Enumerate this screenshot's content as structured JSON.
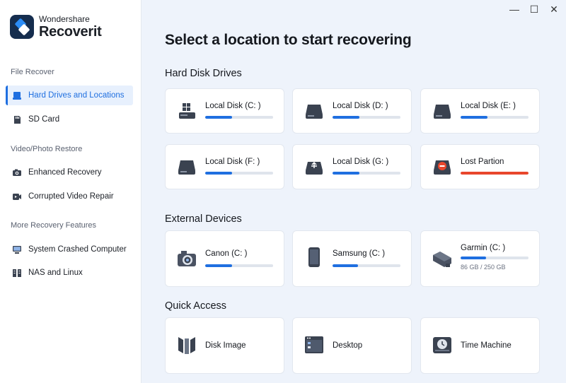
{
  "brand": {
    "line1": "Wondershare",
    "line2": "Recoverit"
  },
  "sidebar": {
    "sections": [
      {
        "label": "File Recover"
      },
      {
        "label": "Video/Photo Restore"
      },
      {
        "label": "More Recovery Features"
      }
    ],
    "items": [
      {
        "label": "Hard Drives and Locations",
        "icon": "hard-drive-icon",
        "active": true
      },
      {
        "label": "SD Card",
        "icon": "sd-card-icon"
      },
      {
        "label": "Enhanced Recovery",
        "icon": "camera-icon"
      },
      {
        "label": "Corrupted Video Repair",
        "icon": "video-repair-icon"
      },
      {
        "label": "System Crashed Computer",
        "icon": "monitor-icon"
      },
      {
        "label": "NAS and Linux",
        "icon": "nas-icon"
      }
    ]
  },
  "window_controls": {
    "minimize": "—",
    "maximize": "☐",
    "close": "✕"
  },
  "main": {
    "title": "Select a location to start recovering",
    "groups": {
      "hard_disk_drives": {
        "title": "Hard Disk Drives",
        "cards": [
          {
            "label": "Local Disk (C: )",
            "icon": "windows-disk-icon",
            "progress": 0.4
          },
          {
            "label": "Local Disk (D: )",
            "icon": "disk-icon",
            "progress": 0.4
          },
          {
            "label": "Local Disk (E: )",
            "icon": "disk-icon",
            "progress": 0.4
          },
          {
            "label": "Local Disk (F: )",
            "icon": "disk-icon",
            "progress": 0.4
          },
          {
            "label": "Local Disk (G: )",
            "icon": "usb-disk-icon",
            "progress": 0.4
          },
          {
            "label": "Lost Partion",
            "icon": "lost-partition-icon",
            "progress": 1.0
          }
        ]
      },
      "external_devices": {
        "title": "External Devices",
        "cards": [
          {
            "label": "Canon (C: )",
            "icon": "camera-device-icon",
            "progress": 0.4
          },
          {
            "label": "Samsung (C: )",
            "icon": "phone-device-icon",
            "progress": 0.38
          },
          {
            "label": "Garmin (C: )",
            "icon": "gps-device-icon",
            "progress": 0.38,
            "sub": "86 GB / 250 GB"
          }
        ]
      },
      "quick_access": {
        "title": "Quick Access",
        "cards": [
          {
            "label": "Disk Image",
            "icon": "disk-image-icon"
          },
          {
            "label": "Desktop",
            "icon": "desktop-icon"
          },
          {
            "label": "Time Machine",
            "icon": "time-machine-icon"
          }
        ]
      }
    }
  },
  "colors": {
    "accent": "#1f6fe0",
    "danger": "#e8462c",
    "background": "#eef3fb"
  }
}
